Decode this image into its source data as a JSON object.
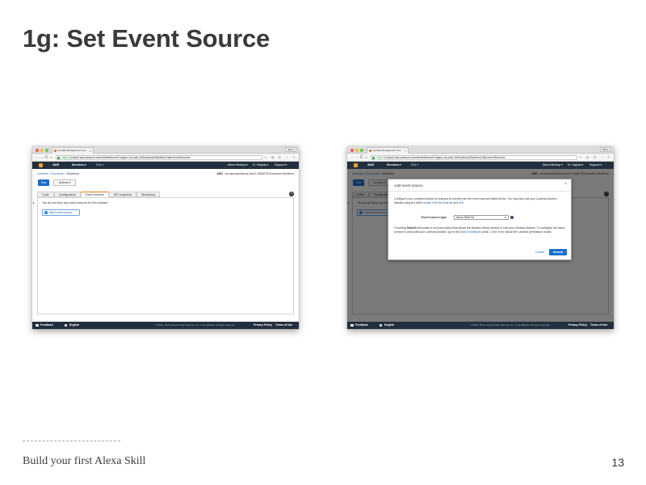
{
  "slide": {
    "title": "1g: Set Event Source",
    "footer_caption": "Build your first Alexa Skill",
    "page_number": "13"
  },
  "browser": {
    "tab_title": "Lambda Management Con",
    "tab_close": "×",
    "user_name": "Brian",
    "url_https": "https://",
    "url_rest": "console.aws.amazon.com/lambda/home?region=us-east-1#/functions/Storiehue?tab=eventSources",
    "nav_back": "←",
    "nav_forward": "→",
    "nav_reload": "C",
    "nav_home": "⌂",
    "toolbar_icons": "☆ ◎ ⓟ ⋮ ≡"
  },
  "aws_nav": {
    "logo_label": "AWS",
    "services": "Services ▾",
    "edit": "Edit ▾",
    "account": "Alexa Meetup ▾",
    "region": "N. Virginia ▾",
    "support": "Support ▾"
  },
  "lambda": {
    "breadcrumb_lambda": "Lambda",
    "breadcrumb_sep1": " > ",
    "breadcrumb_functions": "Functions",
    "breadcrumb_sep2": " > ",
    "breadcrumb_function": "Storiehue",
    "arn_label": "ARN",
    "arn_value": " - arn:aws:lambda:us-east-1:361807815:function:Storiehue",
    "test_button": "Test",
    "actions_button": "Actions ▾",
    "tabs": [
      "Code",
      "Configuration",
      "Event sources",
      "API endpoints",
      "Monitoring"
    ],
    "help_icon": "?",
    "collapse_caret": "▸",
    "no_events_text": "You do not have any event sources for this function.",
    "add_event_plus": "+",
    "add_event_button": "Add event source"
  },
  "footer_bar": {
    "feedback": "Feedback",
    "language": "English",
    "copyright": "© 2008 - 2016, Amazon Web Services, Inc. or its affiliates. All rights reserved.",
    "privacy": "Privacy Policy",
    "terms": "Terms of Use"
  },
  "modal": {
    "title": "Add event source",
    "close": "×",
    "intro_part1": "Configure your Lambda function to respond to events from the event sources listed below. You may also call your Lambda function directly using the AWS ",
    "intro_link1": "mobile SDK",
    "intro_part2": " for ",
    "intro_link2": "Android",
    "intro_part3": " and ",
    "intro_link3": "iOS",
    "intro_part4": ".",
    "event_source_label": "Event source type",
    "event_source_value": "Alexa Skills Kit",
    "select_caret": "▾",
    "info_icon": "i",
    "note_part1": "Choosing ",
    "note_bold": "Submit",
    "note_part2": " will create a resource policy that allows the Amazon Alexa service to call your Lambda function. To configure the Alexa service to work with your Lambda function, go to the ",
    "note_link1": "Alexa Developer",
    "note_part3": " portal. ",
    "note_link2": "Learn more",
    "note_part4": " about the Lambda permission model.",
    "cancel": "Cancel",
    "submit": "Submit"
  }
}
